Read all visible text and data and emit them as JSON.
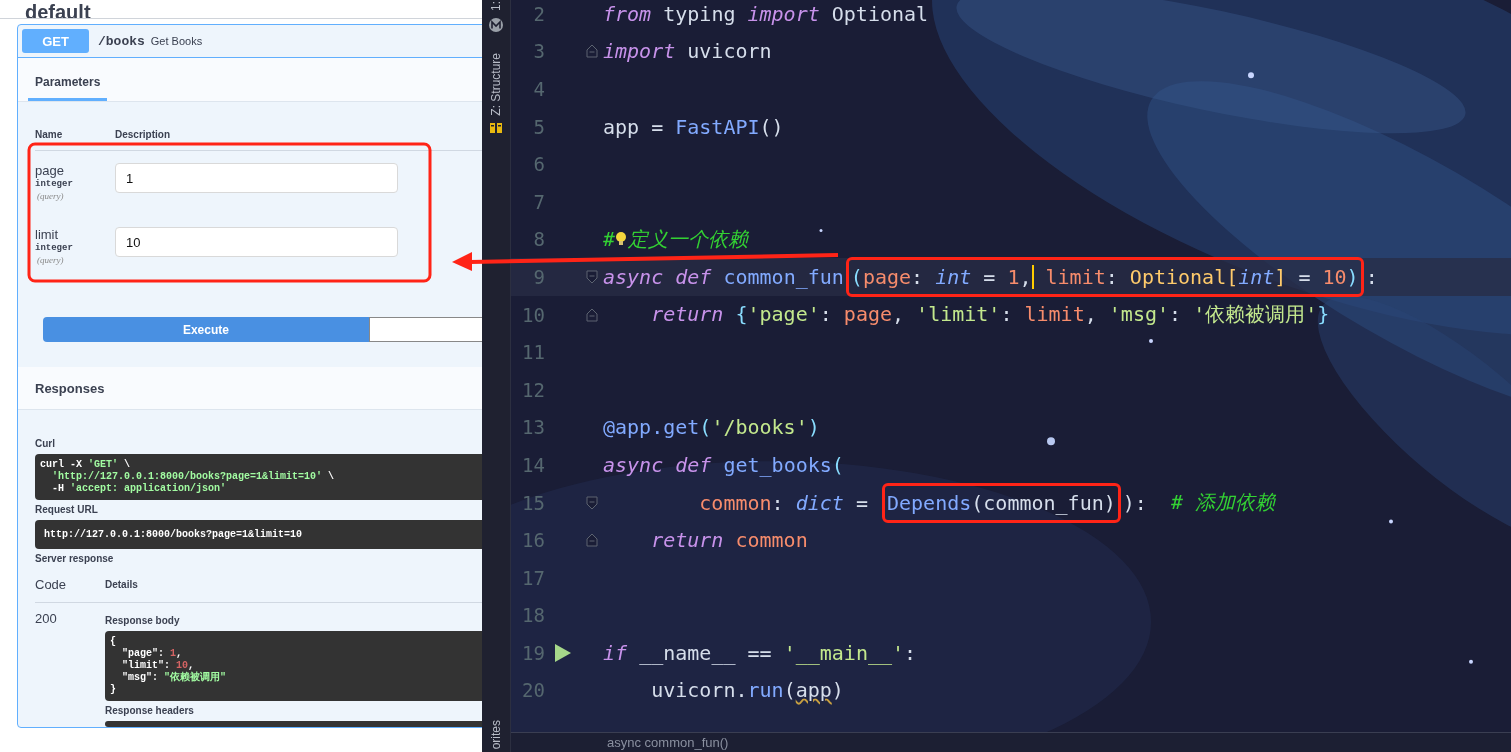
{
  "swagger": {
    "section_title": "default",
    "operation": {
      "method": "GET",
      "path": "/books",
      "summary": "Get Books"
    },
    "tab": {
      "label": "Parameters",
      "selected": true
    },
    "param_columns": [
      "Name",
      "Description"
    ],
    "parameters": [
      {
        "name": "page",
        "type": "integer",
        "location": "(query)",
        "value": "1"
      },
      {
        "name": "limit",
        "type": "integer",
        "location": "(query)",
        "value": "10"
      }
    ],
    "execute_button": "Execute",
    "responses_title": "Responses",
    "curl": {
      "label": "Curl",
      "lines": [
        [
          {
            "text": "curl -X ",
            "kind": "plain"
          },
          {
            "text": "'GET'",
            "kind": "str"
          },
          {
            "text": " \\",
            "kind": "plain"
          }
        ],
        [
          {
            "text": "  'http://127.0.0.1:8000/books?page=1&limit=10'",
            "kind": "str"
          },
          {
            "text": " \\",
            "kind": "plain"
          }
        ],
        [
          {
            "text": "  -H ",
            "kind": "plain"
          },
          {
            "text": "'accept: application/json'",
            "kind": "str"
          }
        ]
      ]
    },
    "request_url": {
      "label": "Request URL",
      "value": "http://127.0.0.1:8000/books?page=1&limit=10"
    },
    "server_response": {
      "label": "Server response",
      "columns": [
        "Code",
        "Details"
      ],
      "code": "200",
      "body_label": "Response body",
      "body_lines": [
        [
          {
            "text": "{",
            "kind": "plain"
          }
        ],
        [
          {
            "text": "  \"page\": ",
            "kind": "plain"
          },
          {
            "text": "1",
            "kind": "num"
          },
          {
            "text": ",",
            "kind": "plain"
          }
        ],
        [
          {
            "text": "  \"limit\": ",
            "kind": "plain"
          },
          {
            "text": "10",
            "kind": "num"
          },
          {
            "text": ",",
            "kind": "plain"
          }
        ],
        [
          {
            "text": "  \"msg\": ",
            "kind": "plain"
          },
          {
            "text": "\"依赖被调用\"",
            "kind": "str"
          }
        ],
        [
          {
            "text": "}",
            "kind": "plain"
          }
        ]
      ],
      "headers_label": "Response headers"
    }
  },
  "editor": {
    "tool_strip": {
      "top": "1:",
      "structure": "Z: Structure",
      "bottom": "orites"
    },
    "lines": [
      {
        "number": "2",
        "tokens": [
          {
            "text": "from",
            "kind": "kw"
          },
          {
            "text": " typing ",
            "kind": "plain"
          },
          {
            "text": "import",
            "kind": "kw"
          },
          {
            "text": " Optional",
            "kind": "plain"
          }
        ]
      },
      {
        "number": "3",
        "fold_close": true,
        "tokens": [
          {
            "text": "import",
            "kind": "kw"
          },
          {
            "text": " uvicorn",
            "kind": "plain"
          }
        ]
      },
      {
        "number": "4"
      },
      {
        "number": "5",
        "tokens": [
          {
            "text": "app = ",
            "kind": "plain"
          },
          {
            "text": "FastAPI",
            "kind": "fn"
          },
          {
            "text": "()",
            "kind": "plain"
          }
        ]
      },
      {
        "number": "6"
      },
      {
        "number": "7"
      },
      {
        "number": "8",
        "bulb": true,
        "tokens": [
          {
            "text": "#",
            "kind": "comment"
          },
          {
            "text": "定义一个依赖",
            "kind": "comment"
          }
        ]
      },
      {
        "number": "9",
        "current": true,
        "fold_open": true,
        "segments": [
          {
            "kind": "code",
            "tokens": [
              {
                "text": "async ",
                "kind": "kw"
              },
              {
                "text": "def ",
                "kind": "kw"
              },
              {
                "text": "common_fun",
                "kind": "fn"
              }
            ]
          },
          {
            "kind": "annotated",
            "tokens": [
              {
                "text": "(",
                "kind": "punc"
              },
              {
                "text": "page",
                "kind": "param"
              },
              {
                "text": ": ",
                "kind": "plain"
              },
              {
                "text": "int",
                "kind": "type"
              },
              {
                "text": " = ",
                "kind": "plain"
              },
              {
                "text": "1",
                "kind": "num"
              },
              {
                "text": ",",
                "kind": "plain",
                "caret": true
              },
              {
                "text": " limit",
                "kind": "param"
              },
              {
                "text": ": ",
                "kind": "plain"
              },
              {
                "text": "Optional[",
                "kind": "cls"
              },
              {
                "text": "int",
                "kind": "type"
              },
              {
                "text": "]",
                "kind": "cls"
              },
              {
                "text": " = ",
                "kind": "plain"
              },
              {
                "text": "10",
                "kind": "num"
              },
              {
                "text": ")",
                "kind": "punc"
              }
            ]
          },
          {
            "kind": "code",
            "tokens": [
              {
                "text": ":",
                "kind": "plain"
              }
            ]
          }
        ]
      },
      {
        "number": "10",
        "fold_close": true,
        "tokens": [
          {
            "text": "    return ",
            "kind": "kw"
          },
          {
            "text": "{",
            "kind": "punc"
          },
          {
            "text": "'page'",
            "kind": "str"
          },
          {
            "text": ": ",
            "kind": "plain"
          },
          {
            "text": "page",
            "kind": "param"
          },
          {
            "text": ", ",
            "kind": "plain"
          },
          {
            "text": "'limit'",
            "kind": "str"
          },
          {
            "text": ": ",
            "kind": "plain"
          },
          {
            "text": "limit",
            "kind": "param"
          },
          {
            "text": ", ",
            "kind": "plain"
          },
          {
            "text": "'msg'",
            "kind": "str"
          },
          {
            "text": ": ",
            "kind": "plain"
          },
          {
            "text": "'依赖被调用'",
            "kind": "str"
          },
          {
            "text": "}",
            "kind": "punc"
          }
        ]
      },
      {
        "number": "11"
      },
      {
        "number": "12"
      },
      {
        "number": "13",
        "tokens": [
          {
            "text": "@app.get",
            "kind": "fn"
          },
          {
            "text": "(",
            "kind": "punc"
          },
          {
            "text": "'/books'",
            "kind": "str"
          },
          {
            "text": ")",
            "kind": "punc"
          }
        ]
      },
      {
        "number": "14",
        "tokens": [
          {
            "text": "async ",
            "kind": "kw"
          },
          {
            "text": "def ",
            "kind": "kw"
          },
          {
            "text": "get_books",
            "kind": "fn"
          },
          {
            "text": "(",
            "kind": "punc"
          }
        ]
      },
      {
        "number": "15",
        "fold_open": true,
        "segments": [
          {
            "kind": "code",
            "tokens": [
              {
                "text": "        common",
                "kind": "param"
              },
              {
                "text": ": ",
                "kind": "plain"
              },
              {
                "text": "dict",
                "kind": "type"
              },
              {
                "text": " = ",
                "kind": "plain"
              }
            ]
          },
          {
            "kind": "annotated",
            "tokens": [
              {
                "text": "Depends",
                "kind": "fn"
              },
              {
                "text": "(common_fun)",
                "kind": "plain"
              }
            ]
          },
          {
            "kind": "code",
            "tokens": [
              {
                "text": "):  ",
                "kind": "plain"
              }
            ]
          },
          {
            "kind": "comment",
            "tokens": [
              {
                "text": "# 添加依赖",
                "kind": "comment"
              }
            ]
          }
        ]
      },
      {
        "number": "16",
        "fold_close": true,
        "tokens": [
          {
            "text": "    return ",
            "kind": "kw"
          },
          {
            "text": "common",
            "kind": "param"
          }
        ]
      },
      {
        "number": "17"
      },
      {
        "number": "18"
      },
      {
        "number": "19",
        "run": true,
        "tokens": [
          {
            "text": "if",
            "kind": "kw"
          },
          {
            "text": " __name__ == ",
            "kind": "plain"
          },
          {
            "text": "'__main__'",
            "kind": "str"
          },
          {
            "text": ":",
            "kind": "plain"
          }
        ]
      },
      {
        "number": "20",
        "tokens": [
          {
            "text": "    uvicorn.",
            "kind": "plain"
          },
          {
            "text": "run",
            "kind": "fn"
          },
          {
            "text": "(",
            "kind": "plain"
          },
          {
            "text": "app",
            "kind": "warn"
          },
          {
            "text": ")",
            "kind": "plain"
          }
        ]
      }
    ],
    "breadcrumb": "async common_fun()"
  }
}
